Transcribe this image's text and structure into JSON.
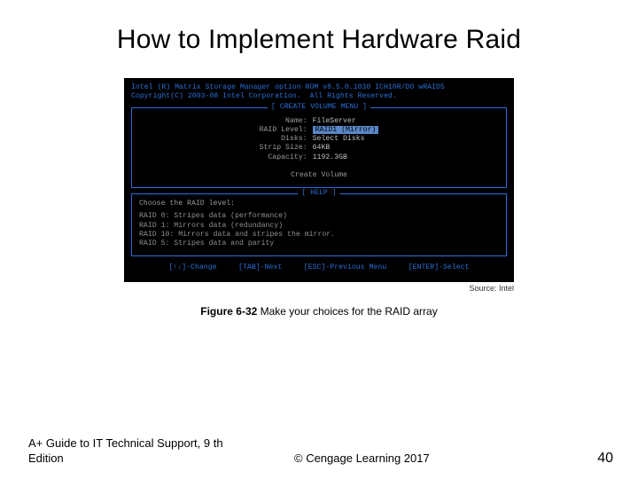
{
  "title": "How to Implement Hardware Raid",
  "bios": {
    "header_line1": "Intel (R) Matrix Storage Manager option ROM v8.5.0.1030 ICH10R/DO wRAID5",
    "header_line2": "Copyright(C) 2003-08 Intel Corporation.  All Rights Reserved.",
    "create_panel_title": "[ CREATE VOLUME MENU ]",
    "fields": {
      "name_label": "Name:",
      "name_value": "FileServer",
      "raid_label": "RAID Level:",
      "raid_value": "RAID1 (Mirror)",
      "disks_label": "Disks:",
      "disks_value": "Select Disks",
      "strip_label": "Strip Size:",
      "strip_value": "64KB",
      "capacity_label": "Capacity:",
      "capacity_value": "1192.3GB"
    },
    "create_volume": "Create Volume",
    "help_panel_title": "[ HELP ]",
    "help_heading": "Choose the RAID level:",
    "help_lines": "RAID 0: Stripes data (performance)\nRAID 1: Mirrors data (redundancy)\nRAID 10: Mirrors data and stripes the mirror.\nRAID 5: Stripes data and parity",
    "nav": "[↑↓]-Change     [TAB]-Next     [ESC]-Previous Menu     [ENTER]-Select"
  },
  "source": "Source: Intel",
  "caption_bold": "Figure 6-32",
  "caption_rest": " Make your choices for the RAID array",
  "footer": {
    "book": "A+ Guide to IT Technical Support, 9 th Edition",
    "copyright": "© Cengage Learning  2017",
    "page": "40"
  }
}
